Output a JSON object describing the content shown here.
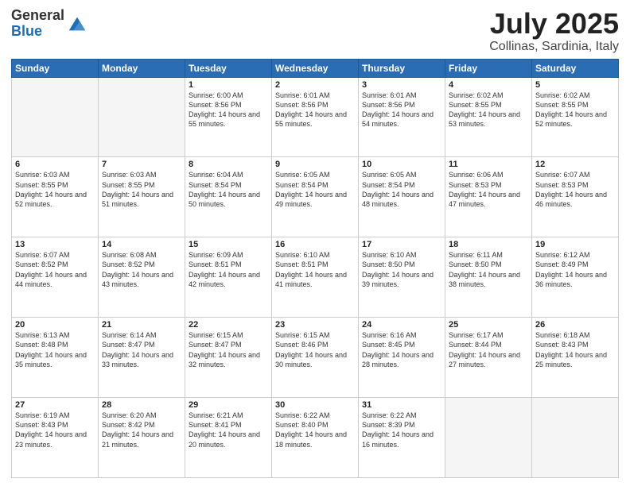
{
  "header": {
    "logo_general": "General",
    "logo_blue": "Blue",
    "main_title": "July 2025",
    "subtitle": "Collinas, Sardinia, Italy"
  },
  "calendar": {
    "headers": [
      "Sunday",
      "Monday",
      "Tuesday",
      "Wednesday",
      "Thursday",
      "Friday",
      "Saturday"
    ],
    "weeks": [
      [
        {
          "day": "",
          "empty": true
        },
        {
          "day": "",
          "empty": true
        },
        {
          "day": "1",
          "sunrise": "Sunrise: 6:00 AM",
          "sunset": "Sunset: 8:56 PM",
          "daylight": "Daylight: 14 hours and 55 minutes."
        },
        {
          "day": "2",
          "sunrise": "Sunrise: 6:01 AM",
          "sunset": "Sunset: 8:56 PM",
          "daylight": "Daylight: 14 hours and 55 minutes."
        },
        {
          "day": "3",
          "sunrise": "Sunrise: 6:01 AM",
          "sunset": "Sunset: 8:56 PM",
          "daylight": "Daylight: 14 hours and 54 minutes."
        },
        {
          "day": "4",
          "sunrise": "Sunrise: 6:02 AM",
          "sunset": "Sunset: 8:55 PM",
          "daylight": "Daylight: 14 hours and 53 minutes."
        },
        {
          "day": "5",
          "sunrise": "Sunrise: 6:02 AM",
          "sunset": "Sunset: 8:55 PM",
          "daylight": "Daylight: 14 hours and 52 minutes."
        }
      ],
      [
        {
          "day": "6",
          "sunrise": "Sunrise: 6:03 AM",
          "sunset": "Sunset: 8:55 PM",
          "daylight": "Daylight: 14 hours and 52 minutes."
        },
        {
          "day": "7",
          "sunrise": "Sunrise: 6:03 AM",
          "sunset": "Sunset: 8:55 PM",
          "daylight": "Daylight: 14 hours and 51 minutes."
        },
        {
          "day": "8",
          "sunrise": "Sunrise: 6:04 AM",
          "sunset": "Sunset: 8:54 PM",
          "daylight": "Daylight: 14 hours and 50 minutes."
        },
        {
          "day": "9",
          "sunrise": "Sunrise: 6:05 AM",
          "sunset": "Sunset: 8:54 PM",
          "daylight": "Daylight: 14 hours and 49 minutes."
        },
        {
          "day": "10",
          "sunrise": "Sunrise: 6:05 AM",
          "sunset": "Sunset: 8:54 PM",
          "daylight": "Daylight: 14 hours and 48 minutes."
        },
        {
          "day": "11",
          "sunrise": "Sunrise: 6:06 AM",
          "sunset": "Sunset: 8:53 PM",
          "daylight": "Daylight: 14 hours and 47 minutes."
        },
        {
          "day": "12",
          "sunrise": "Sunrise: 6:07 AM",
          "sunset": "Sunset: 8:53 PM",
          "daylight": "Daylight: 14 hours and 46 minutes."
        }
      ],
      [
        {
          "day": "13",
          "sunrise": "Sunrise: 6:07 AM",
          "sunset": "Sunset: 8:52 PM",
          "daylight": "Daylight: 14 hours and 44 minutes."
        },
        {
          "day": "14",
          "sunrise": "Sunrise: 6:08 AM",
          "sunset": "Sunset: 8:52 PM",
          "daylight": "Daylight: 14 hours and 43 minutes."
        },
        {
          "day": "15",
          "sunrise": "Sunrise: 6:09 AM",
          "sunset": "Sunset: 8:51 PM",
          "daylight": "Daylight: 14 hours and 42 minutes."
        },
        {
          "day": "16",
          "sunrise": "Sunrise: 6:10 AM",
          "sunset": "Sunset: 8:51 PM",
          "daylight": "Daylight: 14 hours and 41 minutes."
        },
        {
          "day": "17",
          "sunrise": "Sunrise: 6:10 AM",
          "sunset": "Sunset: 8:50 PM",
          "daylight": "Daylight: 14 hours and 39 minutes."
        },
        {
          "day": "18",
          "sunrise": "Sunrise: 6:11 AM",
          "sunset": "Sunset: 8:50 PM",
          "daylight": "Daylight: 14 hours and 38 minutes."
        },
        {
          "day": "19",
          "sunrise": "Sunrise: 6:12 AM",
          "sunset": "Sunset: 8:49 PM",
          "daylight": "Daylight: 14 hours and 36 minutes."
        }
      ],
      [
        {
          "day": "20",
          "sunrise": "Sunrise: 6:13 AM",
          "sunset": "Sunset: 8:48 PM",
          "daylight": "Daylight: 14 hours and 35 minutes."
        },
        {
          "day": "21",
          "sunrise": "Sunrise: 6:14 AM",
          "sunset": "Sunset: 8:47 PM",
          "daylight": "Daylight: 14 hours and 33 minutes."
        },
        {
          "day": "22",
          "sunrise": "Sunrise: 6:15 AM",
          "sunset": "Sunset: 8:47 PM",
          "daylight": "Daylight: 14 hours and 32 minutes."
        },
        {
          "day": "23",
          "sunrise": "Sunrise: 6:15 AM",
          "sunset": "Sunset: 8:46 PM",
          "daylight": "Daylight: 14 hours and 30 minutes."
        },
        {
          "day": "24",
          "sunrise": "Sunrise: 6:16 AM",
          "sunset": "Sunset: 8:45 PM",
          "daylight": "Daylight: 14 hours and 28 minutes."
        },
        {
          "day": "25",
          "sunrise": "Sunrise: 6:17 AM",
          "sunset": "Sunset: 8:44 PM",
          "daylight": "Daylight: 14 hours and 27 minutes."
        },
        {
          "day": "26",
          "sunrise": "Sunrise: 6:18 AM",
          "sunset": "Sunset: 8:43 PM",
          "daylight": "Daylight: 14 hours and 25 minutes."
        }
      ],
      [
        {
          "day": "27",
          "sunrise": "Sunrise: 6:19 AM",
          "sunset": "Sunset: 8:43 PM",
          "daylight": "Daylight: 14 hours and 23 minutes."
        },
        {
          "day": "28",
          "sunrise": "Sunrise: 6:20 AM",
          "sunset": "Sunset: 8:42 PM",
          "daylight": "Daylight: 14 hours and 21 minutes."
        },
        {
          "day": "29",
          "sunrise": "Sunrise: 6:21 AM",
          "sunset": "Sunset: 8:41 PM",
          "daylight": "Daylight: 14 hours and 20 minutes."
        },
        {
          "day": "30",
          "sunrise": "Sunrise: 6:22 AM",
          "sunset": "Sunset: 8:40 PM",
          "daylight": "Daylight: 14 hours and 18 minutes."
        },
        {
          "day": "31",
          "sunrise": "Sunrise: 6:22 AM",
          "sunset": "Sunset: 8:39 PM",
          "daylight": "Daylight: 14 hours and 16 minutes."
        },
        {
          "day": "",
          "empty": true
        },
        {
          "day": "",
          "empty": true
        }
      ]
    ]
  }
}
